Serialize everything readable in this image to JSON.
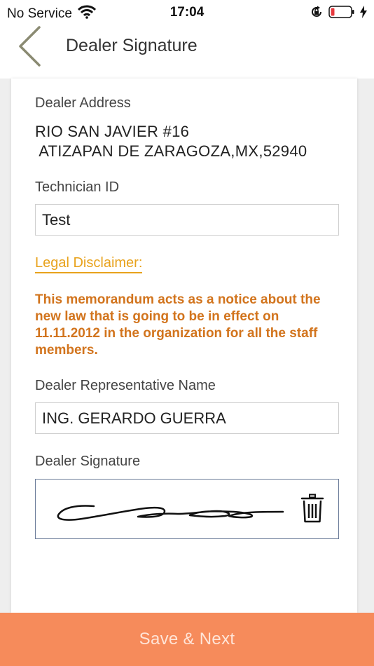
{
  "status_bar": {
    "carrier": "No Service",
    "time": "17:04",
    "icons": [
      "wifi-icon",
      "orientation-lock-icon",
      "battery-low-icon",
      "charging-bolt-icon"
    ]
  },
  "nav": {
    "back_icon": "chevron-left-icon",
    "title": "Dealer Signature"
  },
  "form": {
    "dealer_address_label": "Dealer Address",
    "dealer_address_value": "RIO SAN JAVIER #16\n ATIZAPAN DE ZARAGOZA,MX,52940",
    "technician_id_label": "Technician ID",
    "technician_id_value": "Test",
    "legal_disclaimer_link": "Legal Disclaimer:",
    "legal_disclaimer_text": "This memorandum acts as a notice about the new law that is going to be in effect on 11.11.2012 in the organization for all the staff members.",
    "representative_name_label": "Dealer Representative Name",
    "representative_name_value": "ING. GERARDO GUERRA",
    "signature_label": "Dealer Signature",
    "clear_signature_icon": "trash-icon"
  },
  "footer": {
    "save_next_label": "Save & Next"
  },
  "colors": {
    "accent_orange": "#f68b5b",
    "disclaimer_link": "#e8a21c",
    "disclaimer_text": "#d2741d",
    "back_chevron": "#8a8a72"
  }
}
